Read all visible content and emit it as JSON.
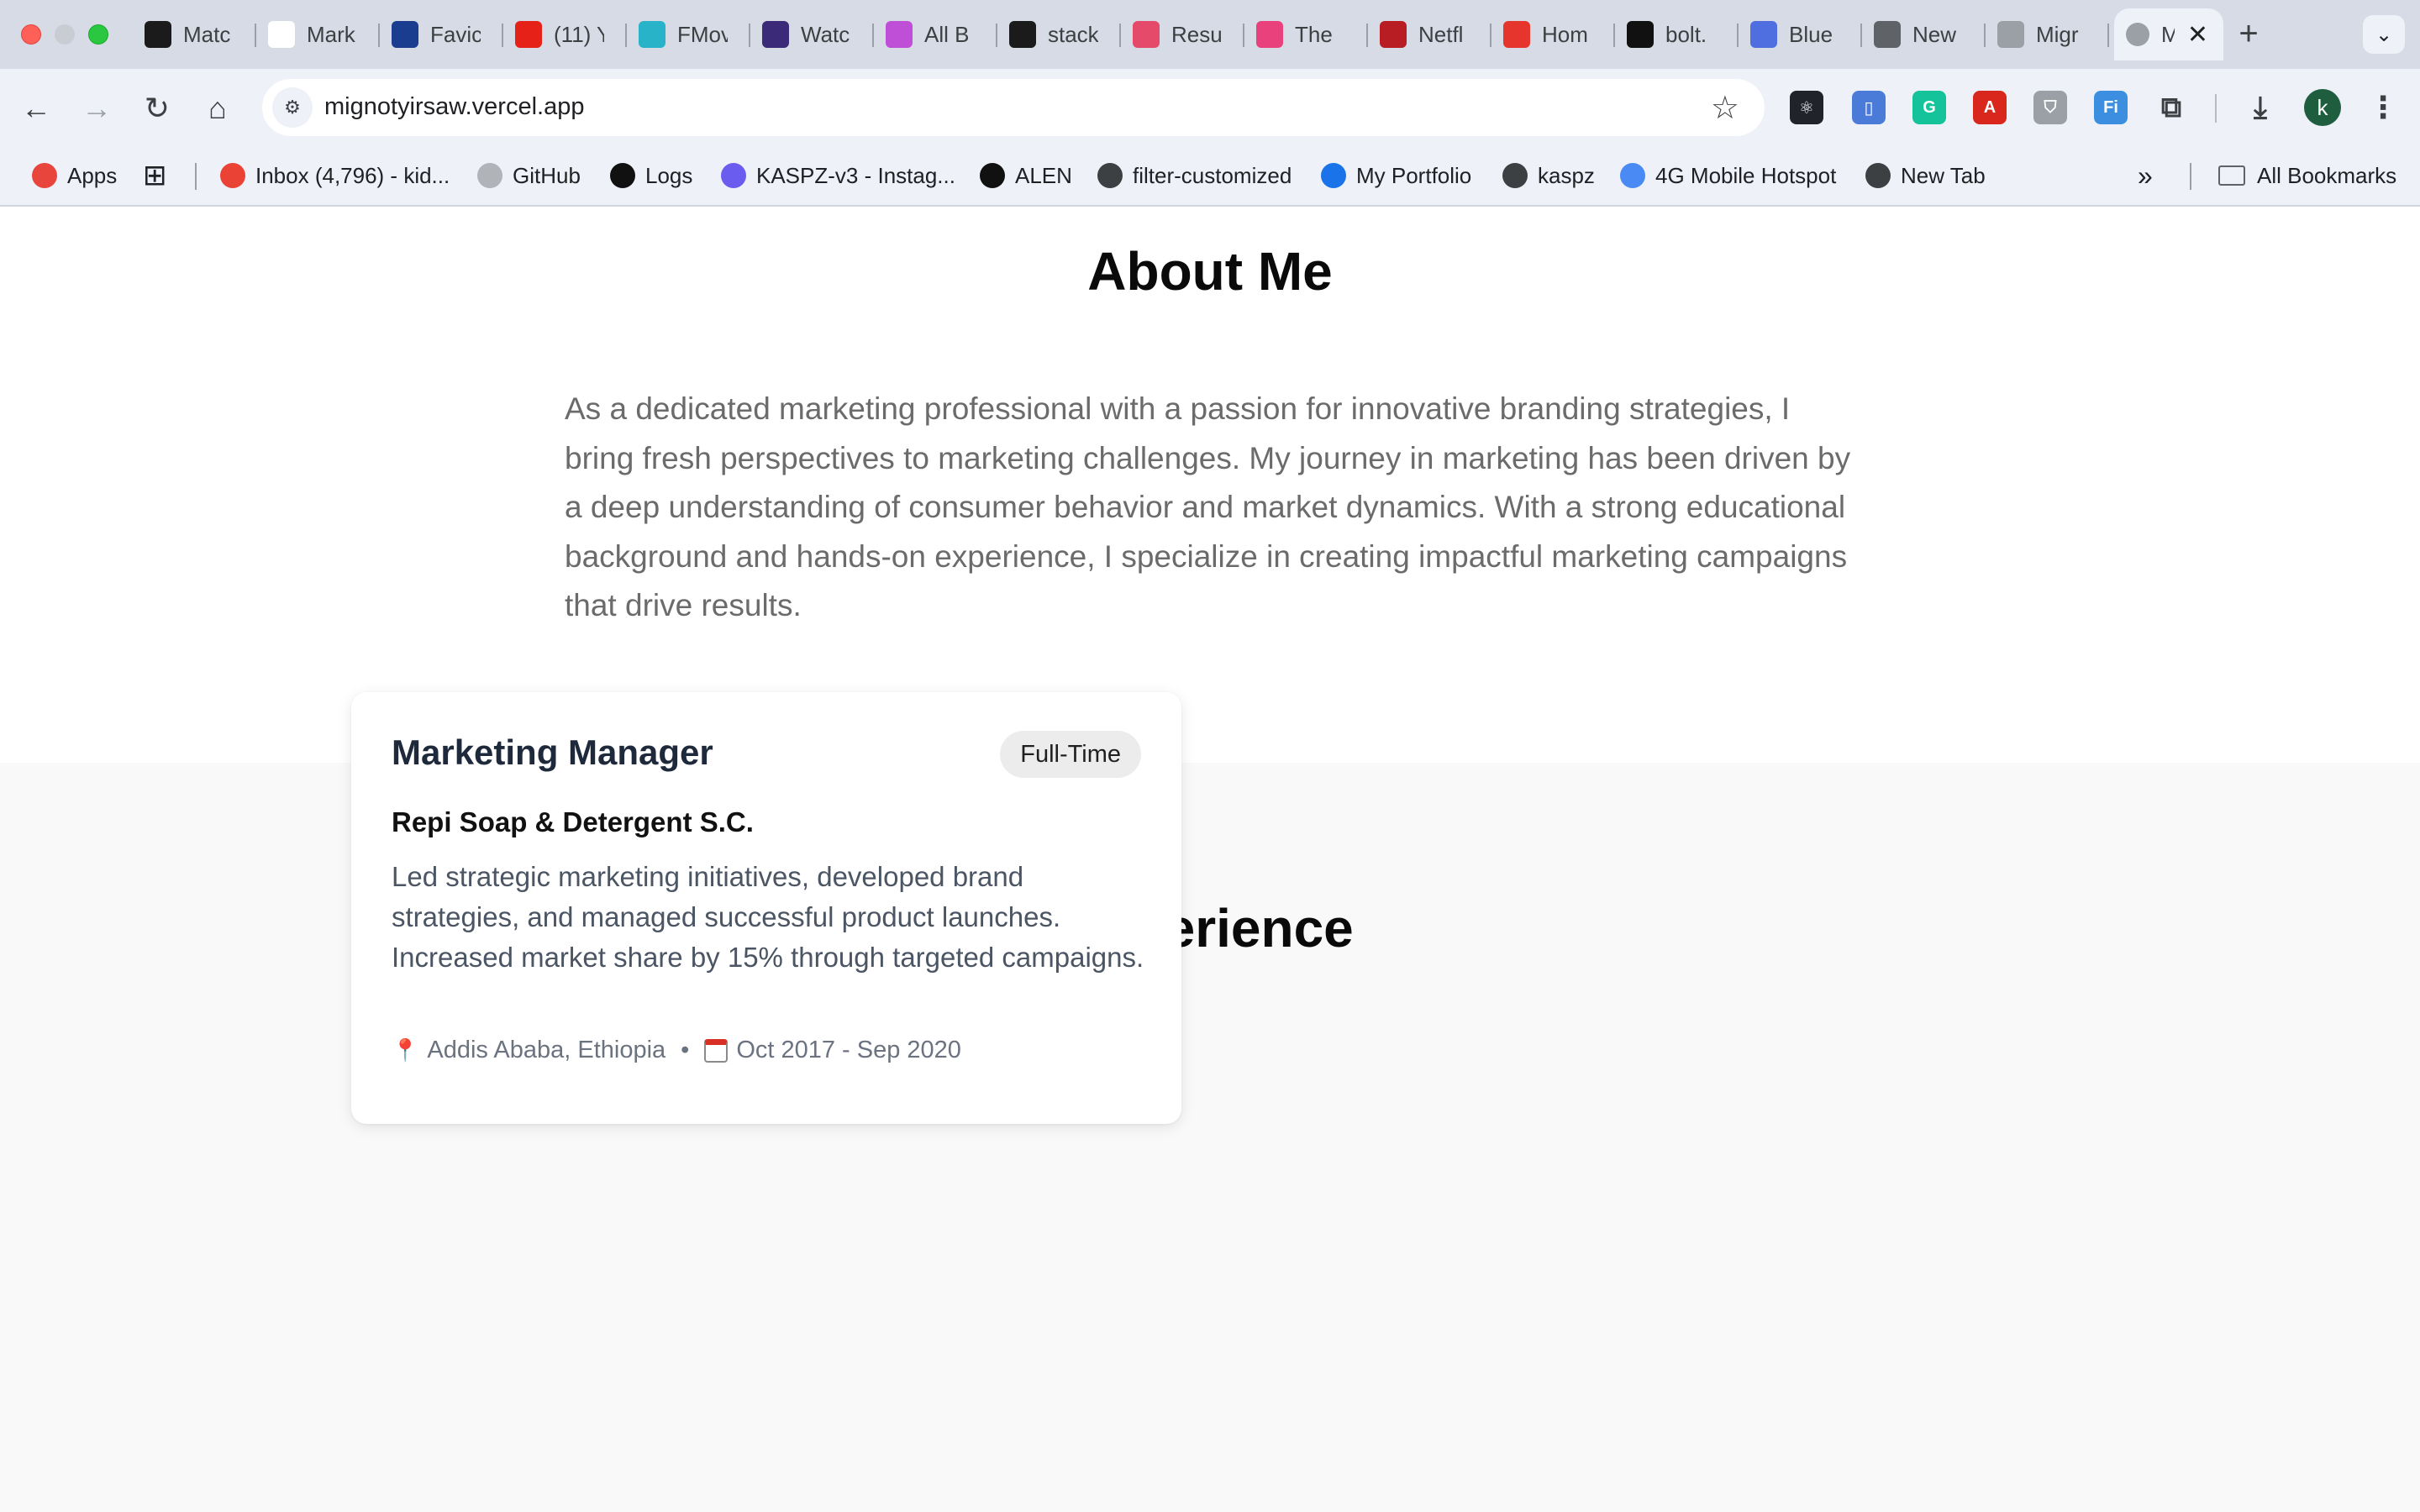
{
  "browser": {
    "tabs": [
      {
        "label": "Matc",
        "icon": "openai-icon",
        "color": "#1b1b1b"
      },
      {
        "label": "Mark",
        "icon": "openai-icon",
        "color": "#ffffff"
      },
      {
        "label": "Favic",
        "icon": "dans-tools-icon",
        "color": "#1a3d8f"
      },
      {
        "label": "(11) Y",
        "icon": "youtube-icon",
        "color": "#e62117"
      },
      {
        "label": "FMov",
        "icon": "play-icon",
        "color": "#28b3c8"
      },
      {
        "label": "Watc",
        "icon": "hianime-icon",
        "color": "#3b2a78"
      },
      {
        "label": "All B",
        "icon": "bolt-icon",
        "color": "#c04fd8"
      },
      {
        "label": "stack",
        "icon": "github-icon",
        "color": "#1b1b1b"
      },
      {
        "label": "Resu",
        "icon": "resume-icon",
        "color": "#e64a6a"
      },
      {
        "label": "The",
        "icon": "gh-icon",
        "color": "#e8417c"
      },
      {
        "label": "Netfl",
        "icon": "netflix-icon",
        "color": "#b81d24"
      },
      {
        "label": "Hom",
        "icon": "ek-icon",
        "color": "#e5352c"
      },
      {
        "label": "bolt.",
        "icon": "bolt-b-icon",
        "color": "#111111"
      },
      {
        "label": "Blue",
        "icon": "printer-icon",
        "color": "#4f6ee0"
      },
      {
        "label": "New",
        "icon": "globe-icon",
        "color": "#5f6368"
      },
      {
        "label": "Migr",
        "icon": "globe-icon",
        "color": "#9aa0a6"
      }
    ],
    "active_tab": {
      "label": "M",
      "icon": "globe-icon"
    },
    "close_glyph": "✕",
    "new_tab_glyph": "+",
    "url": "mignotyirsaw.vercel.app",
    "extensions": [
      {
        "icon": "react-devtools-icon",
        "color": "#20232a",
        "glyph": "⚛"
      },
      {
        "icon": "phone-icon",
        "color": "#4a7bd8",
        "glyph": "▯"
      },
      {
        "icon": "grammarly-icon",
        "color": "#15c39a",
        "glyph": "G"
      },
      {
        "icon": "pdf-icon",
        "color": "#d9271e",
        "glyph": "A"
      },
      {
        "icon": "shield-icon",
        "color": "#9aa0a6",
        "glyph": "⛉"
      },
      {
        "icon": "fi-icon",
        "color": "#3c8fe0",
        "glyph": "Fi"
      }
    ],
    "avatar_letter": "k",
    "bookmarks": [
      {
        "label": "Apps",
        "icon": "apps-grid-icon",
        "color": "#e8453c"
      },
      {
        "label": "Inbox (4,796) - kid...",
        "icon": "gmail-icon",
        "color": "#ea4335"
      },
      {
        "label": "GitHub",
        "icon": "github-icon",
        "color": "#b0b3b8"
      },
      {
        "label": "Logs",
        "icon": "vercel-icon",
        "color": "#111111"
      },
      {
        "label": "KASPZ-v3 - Instag...",
        "icon": "c-logo-icon",
        "color": "#6b5cf0"
      },
      {
        "label": "ALEN",
        "icon": "bowtie-icon",
        "color": "#111111"
      },
      {
        "label": "filter-customized",
        "icon": "globe-icon",
        "color": "#3c4043"
      },
      {
        "label": "My Portfolio",
        "icon": "k-logo-icon",
        "color": "#1a73e8"
      },
      {
        "label": "kaspz",
        "icon": "globe-icon",
        "color": "#3c4043"
      },
      {
        "label": "4G Mobile Hotspot",
        "icon": "hotspot-icon",
        "color": "#4a8af4"
      },
      {
        "label": "New Tab",
        "icon": "globe-icon",
        "color": "#3c4043"
      }
    ],
    "all_bookmarks_label": "All Bookmarks"
  },
  "page": {
    "about": {
      "title": "About Me",
      "text": "As a dedicated marketing professional with a passion for innovative branding strategies, I bring fresh perspectives to marketing challenges. My journey in marketing has been driven by a deep understanding of consumer behavior and market dynamics. With a strong educational background and hands-on experience, I specialize in creating impactful marketing campaigns that drive results."
    },
    "experience": {
      "title": "Experience",
      "items": [
        {
          "role": "Marketing Manager",
          "type": "Full-Time",
          "company": "Repi Soap & Detergent S.C.",
          "description": "Led strategic marketing initiatives, developed brand strategies, and managed successful product launches. Increased market share by 15% through targeted campaigns.",
          "location": "Addis Ababa, Ethiopia",
          "dates": "Oct 2017 - Sep 2020"
        }
      ]
    }
  }
}
